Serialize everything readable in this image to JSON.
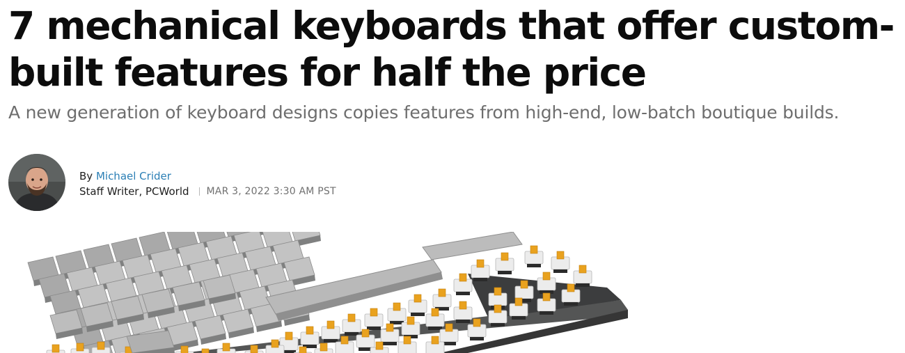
{
  "article": {
    "headline": "7 mechanical keyboards that offer custom-built features for half the price",
    "subheadline": "A new generation of keyboard designs copies features from high-end, low-batch boutique builds."
  },
  "byline": {
    "by_prefix": "By",
    "author_name": "Michael Crider",
    "author_role": "Staff Writer, PCWorld",
    "separator": "|",
    "published": "MAR 3, 2022 3:30 AM PST"
  },
  "hero_image": {
    "alt": "Mechanical keyboard with keycaps partially removed showing orange switches"
  },
  "colors": {
    "headline": "#0c0c0c",
    "subheadline": "#6e6e6e",
    "author_link": "#2b7fb5",
    "date": "#707070"
  }
}
